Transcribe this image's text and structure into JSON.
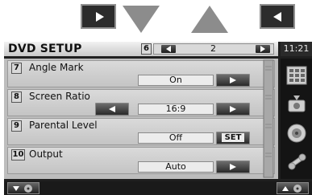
{
  "header": {
    "title": "DVD SETUP",
    "page_number": "2",
    "page_box_number": "6",
    "clock": "11:21"
  },
  "rows": [
    {
      "number": "7",
      "label": "Angle Mark",
      "value": "On",
      "buttons": [
        "right-arrow"
      ]
    },
    {
      "number": "8",
      "label": "Screen Ratio",
      "value": "16:9",
      "buttons": [
        "left-arrow",
        "right-arrow"
      ]
    },
    {
      "number": "9",
      "label": "Parental Level",
      "value": "Off",
      "buttons": [
        "set"
      ],
      "set_label": "SET"
    },
    {
      "number": "10",
      "label": "Output",
      "value": "Auto",
      "buttons": [
        "right-arrow"
      ]
    }
  ],
  "sidebar": {
    "icons": [
      "menu-grid-icon",
      "video-icon",
      "speaker-icon",
      "tools-icon"
    ]
  },
  "colors": {
    "background": "#1f1f1f",
    "panel": "#c4c4c4",
    "button_dark": "#2a2a2a"
  }
}
